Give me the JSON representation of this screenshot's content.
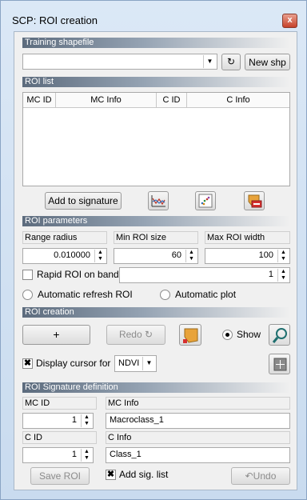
{
  "window": {
    "title": "SCP: ROI creation",
    "close_glyph": "x"
  },
  "training": {
    "header": "Training shapefile",
    "combo_value": "",
    "new_button": "New shp"
  },
  "roi_list": {
    "header": "ROI list",
    "columns": [
      "MC ID",
      "MC Info",
      "C ID",
      "C Info"
    ],
    "rows": [],
    "add_button": "Add to signature"
  },
  "roi_parameters": {
    "header": "ROI parameters",
    "range_radius_label": "Range radius",
    "min_roi_label": "Min ROI size",
    "max_roi_label": "Max ROI width",
    "range_radius_value": "0.010000",
    "min_roi_value": "60",
    "max_roi_value": "100",
    "rapid_label": "Rapid ROI on band",
    "rapid_checked": false,
    "rapid_band": "1",
    "auto_refresh_label": "Automatic refresh ROI",
    "auto_plot_label": "Automatic plot"
  },
  "roi_creation": {
    "header": "ROI creation",
    "plus_button": "+",
    "redo_button": "Redo ↻",
    "show_label": "Show",
    "display_label": "Display cursor for",
    "display_checked": true,
    "cursor_value": "NDVI"
  },
  "signature_def": {
    "header": "ROI Signature definition",
    "mc_id_label": "MC ID",
    "mc_info_label": "MC Info",
    "mc_id_value": "1",
    "mc_info_value": "Macroclass_1",
    "c_id_label": "C ID",
    "c_info_label": "C Info",
    "c_id_value": "1",
    "c_info_value": "Class_1",
    "save_button": "Save ROI",
    "add_sig_label": "Add sig. list",
    "add_sig_checked": true,
    "undo_button": "↶Undo"
  },
  "glyphs": {
    "refresh": "↻",
    "dropdown": "▼",
    "spin_up": "▲",
    "spin_down": "▼",
    "check": "✖"
  },
  "colors": {
    "section_header": "#5c6b7d",
    "window_frame": "#c9dbef",
    "close_red": "#c6412a"
  }
}
